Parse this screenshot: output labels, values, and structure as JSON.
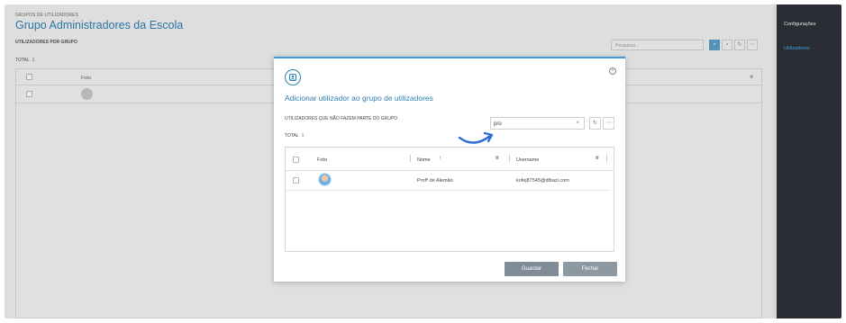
{
  "header": {
    "breadcrumb": "GRUPOS DE UTILIZADORES",
    "title": "Grupo Administradores da Escola",
    "subsection": "UTILIZADORES POR GRUPO",
    "total_label": "TOTAL",
    "total_count": "1",
    "search_placeholder": "Pesquisar..."
  },
  "background_table": {
    "columns": [
      "Foto"
    ]
  },
  "sidebar": {
    "items": [
      {
        "label": "Configurações"
      },
      {
        "label": "Utilizadores"
      }
    ]
  },
  "modal": {
    "title": "Adicionar utilizador ao grupo de utilizadores",
    "subtitle": "UTILIZADORES QUE NÃO FAZEM PARTE DO GRUPO",
    "total_label": "TOTAL",
    "total_count": "1",
    "search_value": "pro",
    "columns": {
      "foto": "Foto",
      "nome": "Nome",
      "username": "Username"
    },
    "rows": [
      {
        "nome": "Profª de Alemão",
        "username": "kofej87545@dlbazi.com"
      }
    ],
    "buttons": {
      "save": "Guardar",
      "close": "Fechar"
    }
  },
  "colors": {
    "accent": "#2d7fb2",
    "sidebar_bg": "#2a2e34",
    "sidebar_active": "#3ba0d6",
    "button_grey": "#7f8c97"
  }
}
